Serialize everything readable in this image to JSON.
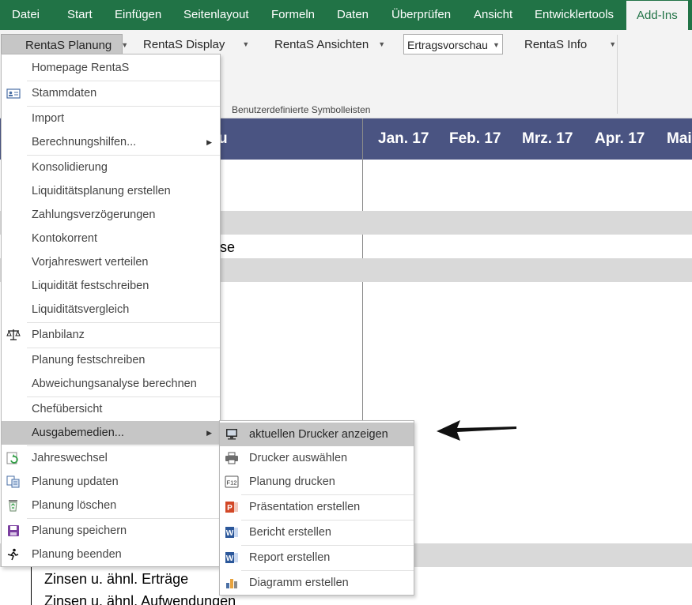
{
  "tabs": [
    {
      "label": "Datei"
    },
    {
      "label": "Start"
    },
    {
      "label": "Einfügen"
    },
    {
      "label": "Seitenlayout"
    },
    {
      "label": "Formeln"
    },
    {
      "label": "Daten"
    },
    {
      "label": "Überprüfen"
    },
    {
      "label": "Ansicht"
    },
    {
      "label": "Entwicklertools"
    },
    {
      "label": "Add-Ins",
      "active": true
    }
  ],
  "ribbon": {
    "planung": "RentaS Planung",
    "display": "RentaS Display",
    "ansichten": "RentaS Ansichten",
    "ertrag_select": "Ertragsvorschau",
    "info": "RentaS Info",
    "group_label": "Benutzerdefinierte Symbolleisten"
  },
  "sheet": {
    "header_fragment": "u",
    "months": [
      "Jan. 17",
      "Feb. 17",
      "Mrz. 17",
      "Apr. 17",
      "Mai"
    ],
    "cell_fragment": "se",
    "row1": "Zinsen u. ähnl. Erträge",
    "row2": "Zinsen u. ähnl. Aufwendungen"
  },
  "menu_main": {
    "items": [
      {
        "label": "Homepage RentaS",
        "icon": ""
      },
      {
        "label": "Stammdaten",
        "icon": "id-card-icon"
      },
      {
        "label": "Import",
        "icon": ""
      },
      {
        "label": "Berechnungshilfen...",
        "icon": "",
        "submenu": true
      },
      {
        "label": "Konsolidierung",
        "icon": ""
      },
      {
        "label": "Liquiditätsplanung erstellen",
        "icon": ""
      },
      {
        "label": "Zahlungsverzögerungen",
        "icon": ""
      },
      {
        "label": "Kontokorrent",
        "icon": ""
      },
      {
        "label": "Vorjahreswert verteilen",
        "icon": ""
      },
      {
        "label": "Liquidität festschreiben",
        "icon": ""
      },
      {
        "label": "Liquiditätsvergleich",
        "icon": ""
      },
      {
        "label": "Planbilanz",
        "icon": "scales-icon"
      },
      {
        "label": "Planung festschreiben",
        "icon": ""
      },
      {
        "label": "Abweichungsanalyse berechnen",
        "icon": ""
      },
      {
        "label": "Chefübersicht",
        "icon": ""
      },
      {
        "label": "Ausgabemedien...",
        "icon": "",
        "submenu": true,
        "highlighted": true
      },
      {
        "label": "Jahreswechsel",
        "icon": "refresh-icon"
      },
      {
        "label": "Planung updaten",
        "icon": "update-icon"
      },
      {
        "label": "Planung löschen",
        "icon": "recycle-bin-icon"
      },
      {
        "label": "Planung speichern",
        "icon": "save-icon"
      },
      {
        "label": "Planung beenden",
        "icon": "exit-icon"
      }
    ]
  },
  "menu_sub": {
    "items": [
      {
        "label": "aktuellen Drucker anzeigen",
        "icon": "monitor-icon",
        "highlighted": true
      },
      {
        "label": "Drucker auswählen",
        "icon": "printer-icon"
      },
      {
        "label": "Planung drucken",
        "icon": "f12-key-icon"
      },
      {
        "label": "Präsentation erstellen",
        "icon": "powerpoint-icon"
      },
      {
        "label": "Bericht erstellen",
        "icon": "word-icon"
      },
      {
        "label": "Report erstellen",
        "icon": "word-icon"
      },
      {
        "label": "Diagramm erstellen",
        "icon": "bar-chart-icon"
      }
    ]
  },
  "colors": {
    "excel_green": "#217346",
    "header_blue": "#4a5482",
    "highlight": "#c6c6c6"
  }
}
